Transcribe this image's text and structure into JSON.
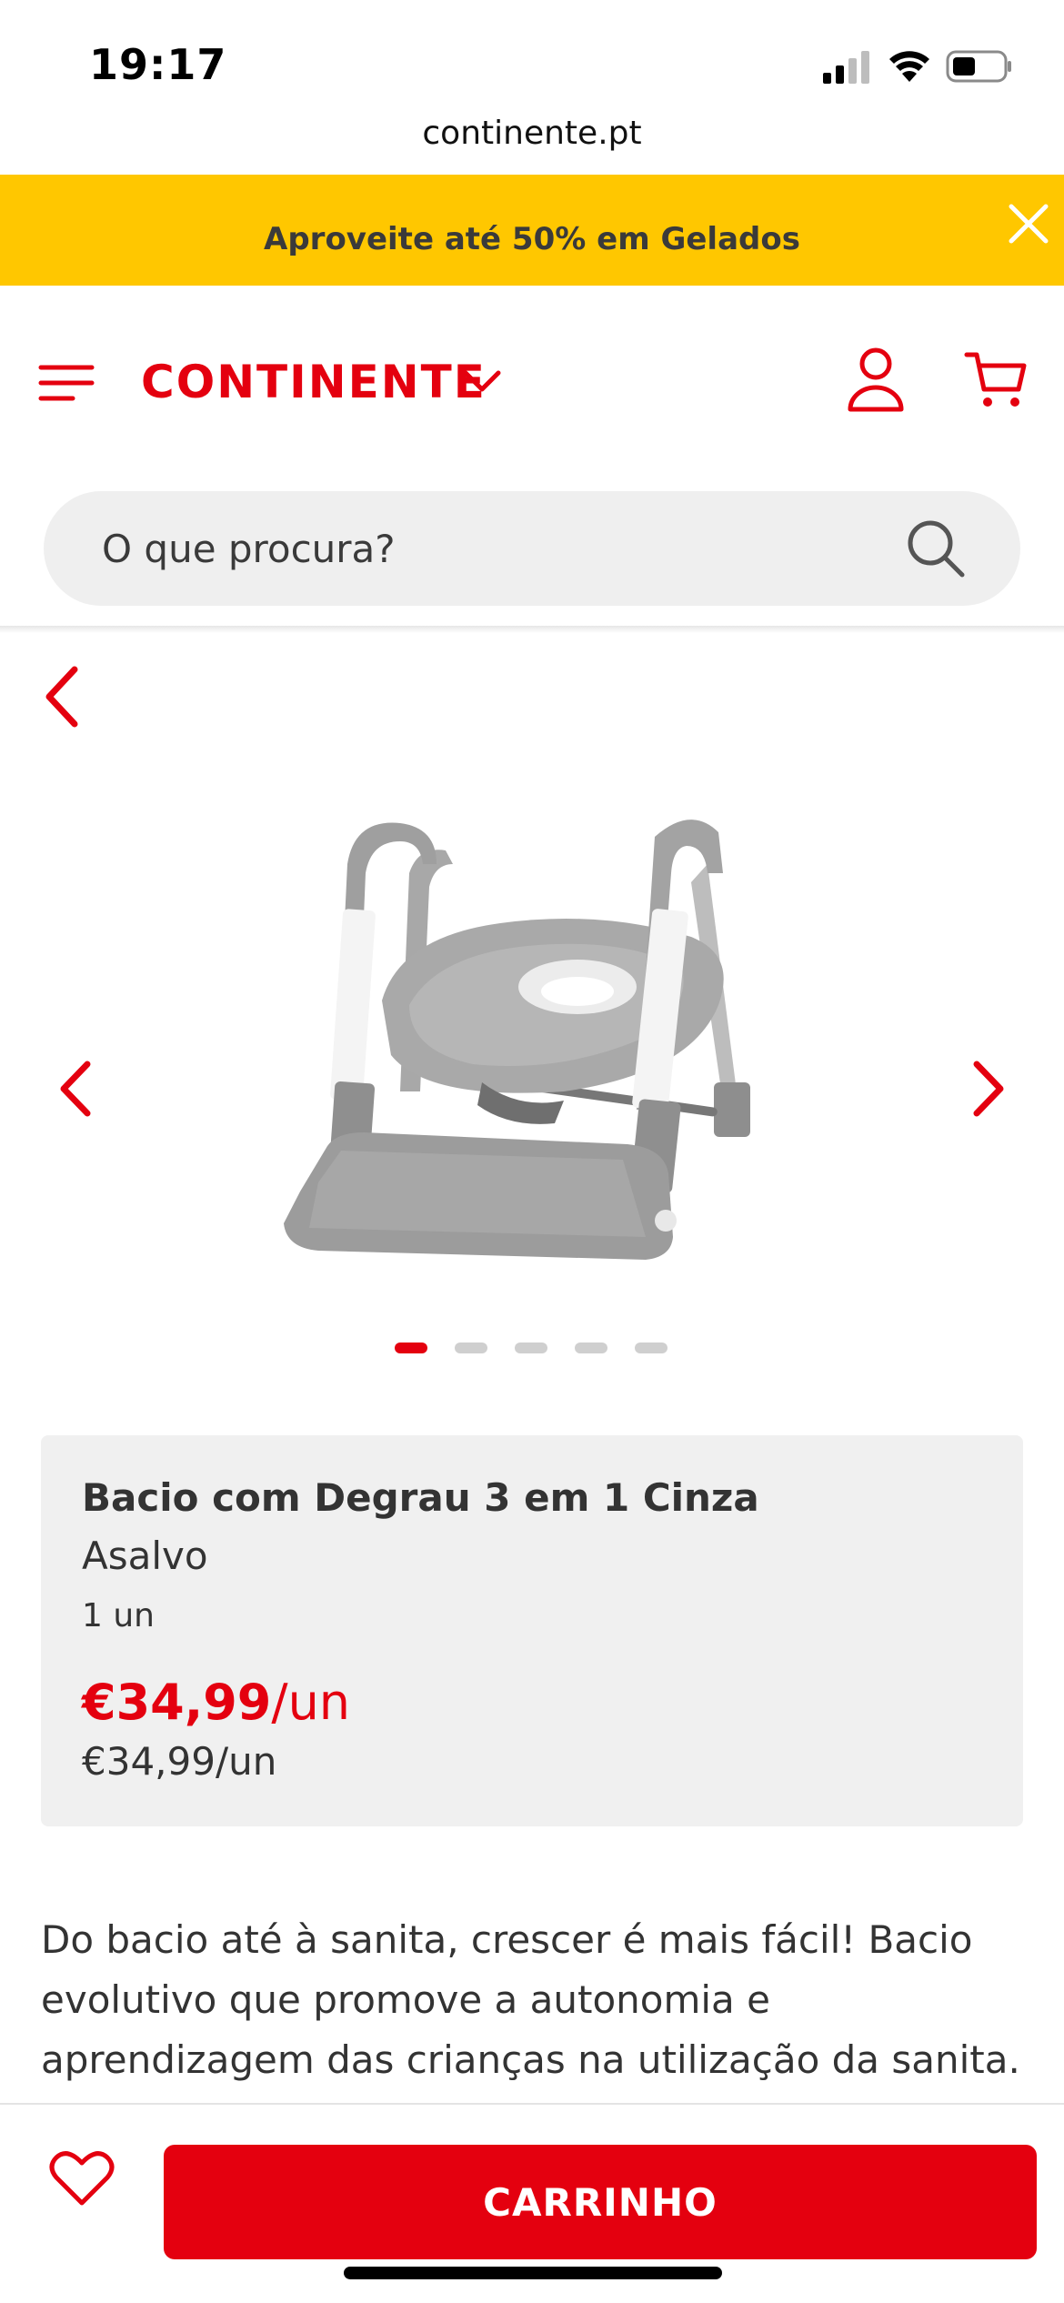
{
  "status_bar": {
    "time": "19:17",
    "icons": [
      "signal-icon",
      "wifi-icon",
      "battery-icon"
    ]
  },
  "browser": {
    "url": "continente.pt"
  },
  "promo_banner": {
    "text": "Aproveite até 50% em Gelados",
    "close_icon": "close-icon",
    "background": "#ffc700"
  },
  "header": {
    "logo_text": "CONTINENTE",
    "icons": [
      "menu-icon",
      "chevron-down-icon",
      "user-icon",
      "cart-icon"
    ],
    "brand_color": "#e4000f"
  },
  "search": {
    "placeholder": "O que procura?",
    "value": "",
    "icon": "search-icon"
  },
  "gallery": {
    "image_count": 5,
    "active_index": 0,
    "icons": [
      "back-icon",
      "chevron-left-icon",
      "chevron-right-icon"
    ]
  },
  "product": {
    "name": "Bacio com Degrau 3 em 1 Cinza",
    "brand": "Asalvo",
    "quantity": "1 un",
    "price": "€34,99",
    "price_unit": "/un",
    "unit_price": "€34,99/un",
    "price_color": "#e4000f"
  },
  "description": "Do bacio até à sanita, crescer é mais fácil! Bacio evolutivo que promove a autonomia e aprendizagem das crianças na utilização da sanita.",
  "bottom_bar": {
    "favorite_icon": "heart-icon",
    "cart_button_label": "CARRINHO"
  }
}
